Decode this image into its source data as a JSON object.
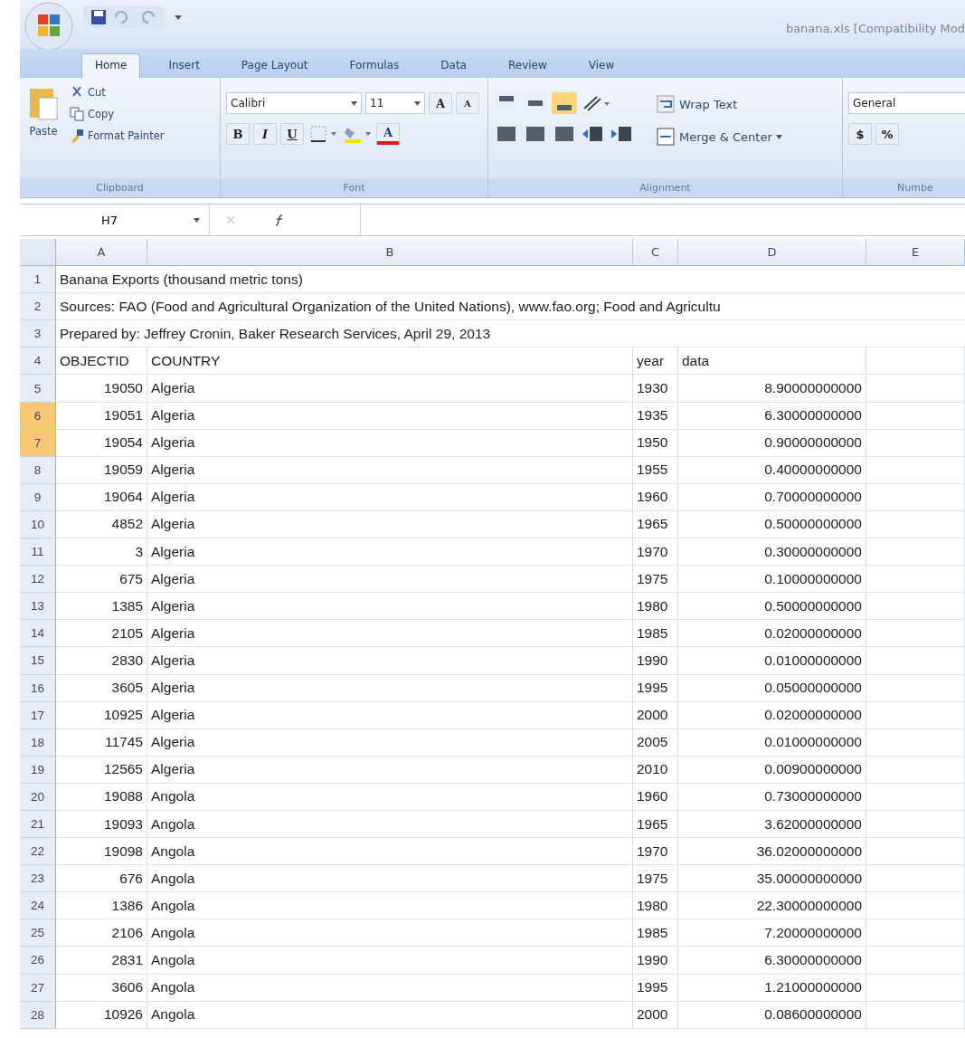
{
  "window": {
    "title": "banana.xls  [Compatibility Mod"
  },
  "tabs": [
    {
      "label": "Home",
      "selected": true
    },
    {
      "label": "Insert",
      "selected": false
    },
    {
      "label": "Page Layout",
      "selected": false
    },
    {
      "label": "Formulas",
      "selected": false
    },
    {
      "label": "Data",
      "selected": false
    },
    {
      "label": "Review",
      "selected": false
    },
    {
      "label": "View",
      "selected": false
    }
  ],
  "ribbon": {
    "clipboard": {
      "paste": "Paste",
      "cut": "Cut",
      "copy": "Copy",
      "format_painter": "Format Painter",
      "label": "Clipboard"
    },
    "font": {
      "font_name": "Calibri",
      "font_size": "11",
      "grow": "A",
      "shrink": "A",
      "bold": "B",
      "italic": "I",
      "underline": "U",
      "font_color": "A",
      "label": "Font"
    },
    "alignment": {
      "wrap_text": "Wrap Text",
      "merge_center": "Merge & Center",
      "label": "Alignment"
    },
    "number": {
      "format": "General",
      "currency": "$",
      "percent": "%",
      "label": "Numbe"
    }
  },
  "name_box": "H7",
  "columns": [
    "A",
    "B",
    "C",
    "D",
    "E"
  ],
  "rows": [
    {
      "number": "1",
      "selected": false,
      "kind": "note",
      "text": "Banana Exports (thousand metric tons)"
    },
    {
      "number": "2",
      "selected": false,
      "kind": "note",
      "text": "Sources: FAO (Food and Agricultural Organization of the United Nations), www.fao.org; Food and Agricultu"
    },
    {
      "number": "3",
      "selected": false,
      "kind": "note",
      "text": "Prepared by: Jeffrey Cronin, Baker Research Services, April 29, 2013"
    },
    {
      "number": "4",
      "selected": false,
      "kind": "header",
      "cells": [
        "OBJECTID",
        "COUNTRY",
        "year",
        "data"
      ]
    },
    {
      "number": "5",
      "selected": false,
      "kind": "data",
      "cells": [
        "19050",
        "Algeria",
        "1930",
        "8.90000000000"
      ]
    },
    {
      "number": "6",
      "selected": true,
      "kind": "data",
      "cells": [
        "19051",
        "Algeria",
        "1935",
        "6.30000000000"
      ]
    },
    {
      "number": "7",
      "selected": true,
      "kind": "data",
      "cells": [
        "19054",
        "Algeria",
        "1950",
        "0.90000000000"
      ]
    },
    {
      "number": "8",
      "selected": false,
      "kind": "data",
      "cells": [
        "19059",
        "Algeria",
        "1955",
        "0.40000000000"
      ]
    },
    {
      "number": "9",
      "selected": false,
      "kind": "data",
      "cells": [
        "19064",
        "Algeria",
        "1960",
        "0.70000000000"
      ]
    },
    {
      "number": "10",
      "selected": false,
      "kind": "data",
      "cells": [
        "4852",
        "Algeria",
        "1965",
        "0.50000000000"
      ]
    },
    {
      "number": "11",
      "selected": false,
      "kind": "data",
      "cells": [
        "3",
        "Algeria",
        "1970",
        "0.30000000000"
      ]
    },
    {
      "number": "12",
      "selected": false,
      "kind": "data",
      "cells": [
        "675",
        "Algeria",
        "1975",
        "0.10000000000"
      ]
    },
    {
      "number": "13",
      "selected": false,
      "kind": "data",
      "cells": [
        "1385",
        "Algeria",
        "1980",
        "0.50000000000"
      ]
    },
    {
      "number": "14",
      "selected": false,
      "kind": "data",
      "cells": [
        "2105",
        "Algeria",
        "1985",
        "0.02000000000"
      ]
    },
    {
      "number": "15",
      "selected": false,
      "kind": "data",
      "cells": [
        "2830",
        "Algeria",
        "1990",
        "0.01000000000"
      ]
    },
    {
      "number": "16",
      "selected": false,
      "kind": "data",
      "cells": [
        "3605",
        "Algeria",
        "1995",
        "0.05000000000"
      ]
    },
    {
      "number": "17",
      "selected": false,
      "kind": "data",
      "cells": [
        "10925",
        "Algeria",
        "2000",
        "0.02000000000"
      ]
    },
    {
      "number": "18",
      "selected": false,
      "kind": "data",
      "cells": [
        "11745",
        "Algeria",
        "2005",
        "0.01000000000"
      ]
    },
    {
      "number": "19",
      "selected": false,
      "kind": "data",
      "cells": [
        "12565",
        "Algeria",
        "2010",
        "0.00900000000"
      ]
    },
    {
      "number": "20",
      "selected": false,
      "kind": "data",
      "cells": [
        "19088",
        "Angola",
        "1960",
        "0.73000000000"
      ]
    },
    {
      "number": "21",
      "selected": false,
      "kind": "data",
      "cells": [
        "19093",
        "Angola",
        "1965",
        "3.62000000000"
      ]
    },
    {
      "number": "22",
      "selected": false,
      "kind": "data",
      "cells": [
        "19098",
        "Angola",
        "1970",
        "36.02000000000"
      ]
    },
    {
      "number": "23",
      "selected": false,
      "kind": "data",
      "cells": [
        "676",
        "Angola",
        "1975",
        "35.00000000000"
      ]
    },
    {
      "number": "24",
      "selected": false,
      "kind": "data",
      "cells": [
        "1386",
        "Angola",
        "1980",
        "22.30000000000"
      ]
    },
    {
      "number": "25",
      "selected": false,
      "kind": "data",
      "cells": [
        "2106",
        "Angola",
        "1985",
        "7.20000000000"
      ]
    },
    {
      "number": "26",
      "selected": false,
      "kind": "data",
      "cells": [
        "2831",
        "Angola",
        "1990",
        "6.30000000000"
      ]
    },
    {
      "number": "27",
      "selected": false,
      "kind": "data",
      "cells": [
        "3606",
        "Angola",
        "1995",
        "1.21000000000"
      ]
    },
    {
      "number": "28",
      "selected": false,
      "kind": "data",
      "cells": [
        "10926",
        "Angola",
        "2000",
        "0.08600000000"
      ]
    }
  ]
}
